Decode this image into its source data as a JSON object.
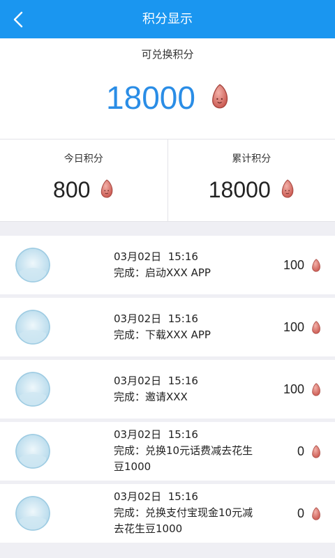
{
  "header": {
    "title": "积分显示",
    "back_icon": "chevron-left-icon"
  },
  "summary": {
    "label": "可兑换积分",
    "value": "18000",
    "icon": "peanut-seed-icon"
  },
  "stats": [
    {
      "label": "今日积分",
      "value": "800"
    },
    {
      "label": "累计积分",
      "value": "18000"
    }
  ],
  "records": [
    {
      "time": "03月02日  15:16",
      "desc": "完成：启动XXX APP",
      "points": "100"
    },
    {
      "time": "03月02日  15:16",
      "desc": "完成：下载XXX APP",
      "points": "100"
    },
    {
      "time": "03月02日  15:16",
      "desc": "完成：邀请XXX",
      "points": "100"
    },
    {
      "time": "03月02日  15:16",
      "desc": "完成：兑换10元话费减去花生豆1000",
      "points": "0"
    },
    {
      "time": "03月02日  15:16",
      "desc": "完成：兑换支付宝现金10元减去花生豆1000",
      "points": "0"
    }
  ],
  "colors": {
    "accent": "#1a96f0",
    "value_blue": "#2a8de6",
    "seed": "#d9706a"
  }
}
